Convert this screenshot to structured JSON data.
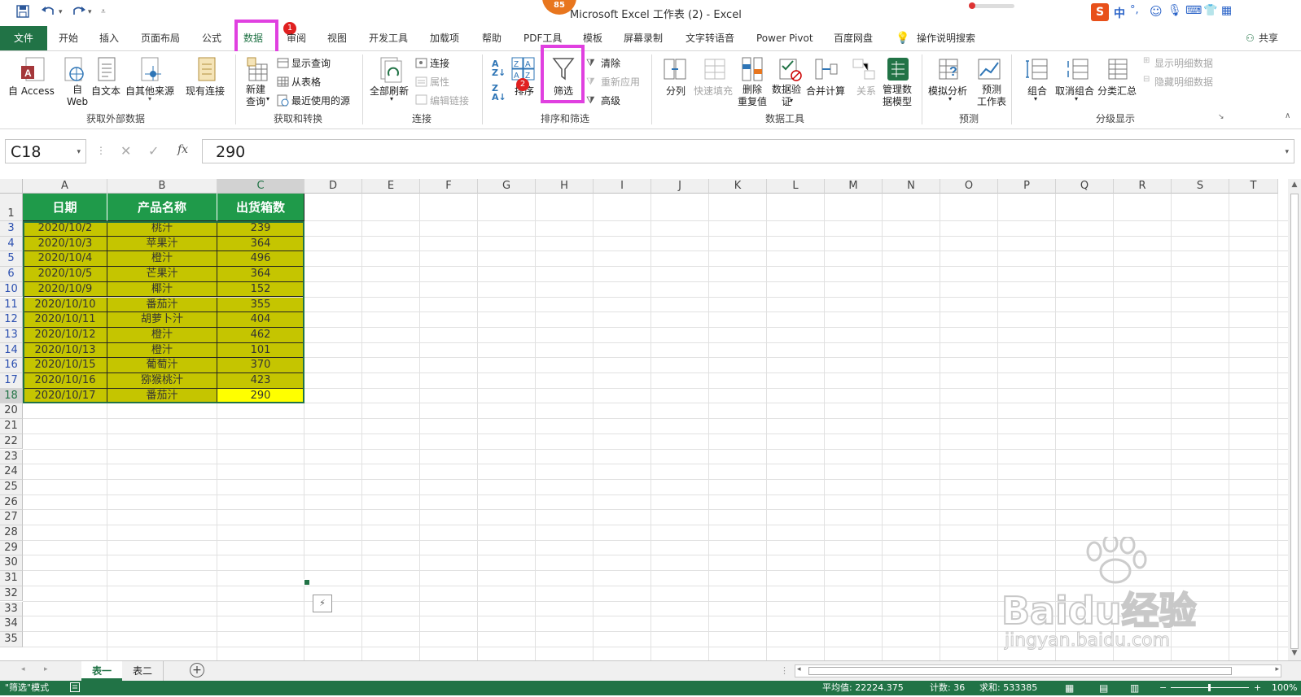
{
  "window": {
    "title": "Microsoft Excel 工作表 (2)  -  Excel",
    "badge": "85",
    "ime_label": "中"
  },
  "tabs": {
    "file": "文件",
    "items": [
      "开始",
      "插入",
      "页面布局",
      "公式",
      "数据",
      "审阅",
      "视图",
      "开发工具",
      "加载项",
      "帮助",
      "PDF工具",
      "模板",
      "屏幕录制",
      "文字转语音",
      "Power Pivot",
      "百度网盘"
    ],
    "active": "数据",
    "search": "操作说明搜索",
    "share": "共享",
    "step1": "1"
  },
  "ribbon": {
    "get_external": {
      "access": "自 Access",
      "web": "自\nWeb",
      "text": "自文本",
      "other": "自其他来源",
      "existing": "现有连接",
      "group": "获取外部数据"
    },
    "get_transform": {
      "new_query": "新建\n查询",
      "show_queries": "显示查询",
      "from_table": "从表格",
      "recent": "最近使用的源",
      "group": "获取和转换"
    },
    "connections": {
      "refresh_all": "全部刷新",
      "connections": "连接",
      "properties": "属性",
      "edit_links": "编辑链接",
      "group": "连接"
    },
    "sort_filter": {
      "sort": "排序",
      "filter": "筛选",
      "clear": "清除",
      "reapply": "重新应用",
      "advanced": "高级",
      "step2": "2",
      "group": "排序和筛选"
    },
    "data_tools": {
      "text_to_columns": "分列",
      "flash_fill": "快速填充",
      "remove_dup": "删除\n重复值",
      "validation": "数据验\n证",
      "consolidate": "合并计算",
      "relationships": "关系",
      "manage_model": "管理数\n据模型",
      "group": "数据工具"
    },
    "forecast": {
      "what_if": "模拟分析",
      "sheet": "预测\n工作表",
      "group": "预测"
    },
    "outline": {
      "group_btn": "组合",
      "ungroup": "取消组合",
      "subtotal": "分类汇总",
      "show_detail": "显示明细数据",
      "hide_detail": "隐藏明细数据",
      "group": "分级显示"
    }
  },
  "formula_bar": {
    "name_box": "C18",
    "value": "290",
    "fx": "fx"
  },
  "grid": {
    "columns": [
      "A",
      "B",
      "C",
      "D",
      "E",
      "F",
      "G",
      "H",
      "I",
      "J",
      "K",
      "L",
      "M",
      "N",
      "O",
      "P",
      "Q",
      "R",
      "S",
      "T"
    ],
    "header_row_num": "1",
    "headers": [
      "日期",
      "产品名称",
      "出货箱数"
    ],
    "rows": [
      {
        "num": "3",
        "date": "2020/10/2",
        "product": "桃汁",
        "qty": "239"
      },
      {
        "num": "4",
        "date": "2020/10/3",
        "product": "苹果汁",
        "qty": "364"
      },
      {
        "num": "5",
        "date": "2020/10/4",
        "product": "橙汁",
        "qty": "496"
      },
      {
        "num": "6",
        "date": "2020/10/5",
        "product": "芒果汁",
        "qty": "364"
      },
      {
        "num": "10",
        "date": "2020/10/9",
        "product": "椰汁",
        "qty": "152"
      },
      {
        "num": "11",
        "date": "2020/10/10",
        "product": "番茄汁",
        "qty": "355"
      },
      {
        "num": "12",
        "date": "2020/10/11",
        "product": "胡萝卜汁",
        "qty": "404"
      },
      {
        "num": "13",
        "date": "2020/10/12",
        "product": "橙汁",
        "qty": "462"
      },
      {
        "num": "14",
        "date": "2020/10/13",
        "product": "橙汁",
        "qty": "101"
      },
      {
        "num": "16",
        "date": "2020/10/15",
        "product": "葡萄汁",
        "qty": "370"
      },
      {
        "num": "17",
        "date": "2020/10/16",
        "product": "猕猴桃汁",
        "qty": "423"
      },
      {
        "num": "18",
        "date": "2020/10/17",
        "product": "番茄汁",
        "qty": "290"
      }
    ],
    "empty_rows": [
      "20",
      "21",
      "22",
      "23",
      "24",
      "25",
      "26",
      "27",
      "28",
      "29",
      "30",
      "31",
      "32",
      "33",
      "34",
      "35"
    ]
  },
  "sheets": {
    "items": [
      "表一",
      "表二"
    ],
    "active": "表一"
  },
  "status": {
    "mode": "\"筛选\"模式",
    "average": "平均值: 22224.375",
    "count": "计数: 36",
    "sum": "求和: 533385",
    "zoom": "100%"
  },
  "watermark": "Baidu经验",
  "watermark_url": "jingyan.baidu.com",
  "colors": {
    "excel_green": "#217346",
    "header_fill": "#1f9a4a",
    "data_fill": "#c5c500",
    "active_cell": "#ffff00",
    "highlight": "#e040e0"
  }
}
